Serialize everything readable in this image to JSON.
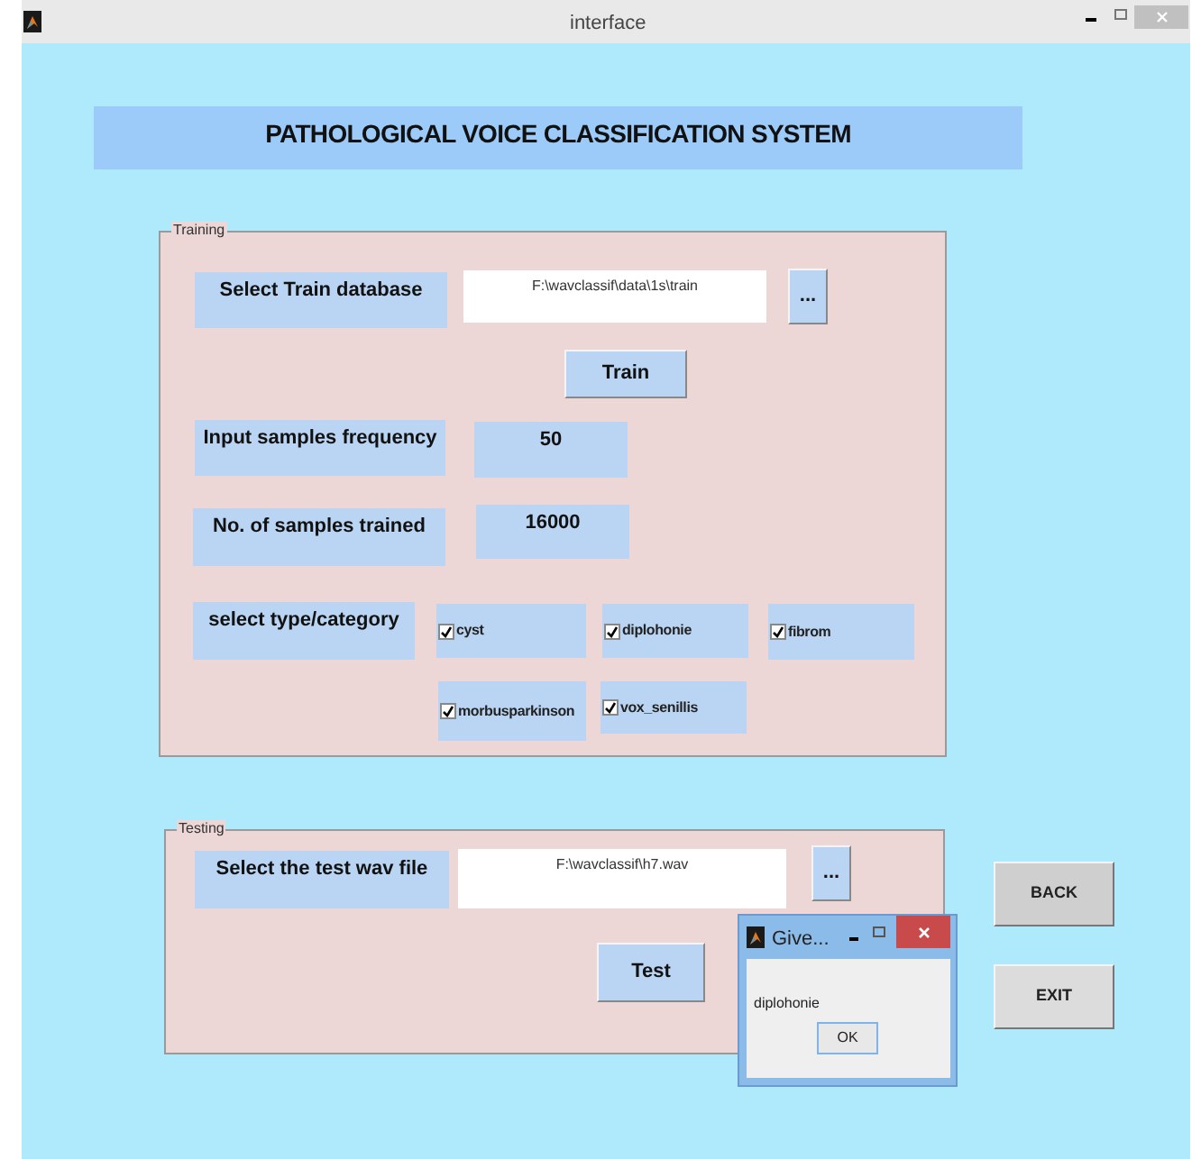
{
  "window": {
    "title": "interface"
  },
  "header": {
    "title": "PATHOLOGICAL VOICE CLASSIFICATION SYSTEM"
  },
  "training": {
    "title": "Training",
    "database_label": "Select Train database",
    "database_path": "F:\\wavclassif\\data\\1s\\train",
    "browse_button": "...",
    "train_button": "Train",
    "frequency_label": "Input samples frequency",
    "frequency_value": "50",
    "samples_label": "No. of samples trained",
    "samples_value": "16000",
    "category_label": "select type/category",
    "categories": [
      {
        "label": "cyst",
        "checked": true
      },
      {
        "label": "diplohonie",
        "checked": true
      },
      {
        "label": "fibrom",
        "checked": true
      },
      {
        "label": "morbusparkinson",
        "checked": true
      },
      {
        "label": "vox_senillis",
        "checked": true
      }
    ]
  },
  "testing": {
    "title": "Testing",
    "file_label": "Select the test wav file",
    "file_path": "F:\\wavclassif\\h7.wav",
    "browse_button": "...",
    "test_button": "Test"
  },
  "buttons": [
    "BACK",
    "EXIT"
  ],
  "dialog": {
    "title": "Give...",
    "message": "diplohonie",
    "ok_button": "OK"
  }
}
